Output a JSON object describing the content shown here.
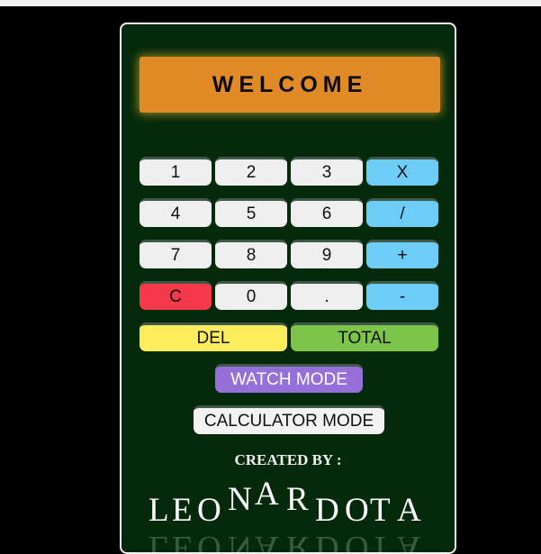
{
  "calculator": {
    "display_text": "WELCOME",
    "keys": {
      "k1": "1",
      "k2": "2",
      "k3": "3",
      "times": "X",
      "k4": "4",
      "k5": "5",
      "k6": "6",
      "divide": "/",
      "k7": "7",
      "k8": "8",
      "k9": "9",
      "plus": "+",
      "clear": "C",
      "k0": "0",
      "dot": ".",
      "minus": "-",
      "del": "DEL",
      "total": "TOTAL"
    },
    "watch_mode_label": "WATCH MODE",
    "calculator_mode_label": "CALCULATOR MODE"
  },
  "credits": {
    "created_by": "CREATED BY :",
    "author": "LEONARDOTA"
  },
  "colors": {
    "display": "#e08b28",
    "operator": "#6dcdf7",
    "clear": "#f4394a",
    "del": "#fded5c",
    "total": "#7dc54a",
    "watch_mode": "#9670d9",
    "card_background": "#052a0b"
  }
}
